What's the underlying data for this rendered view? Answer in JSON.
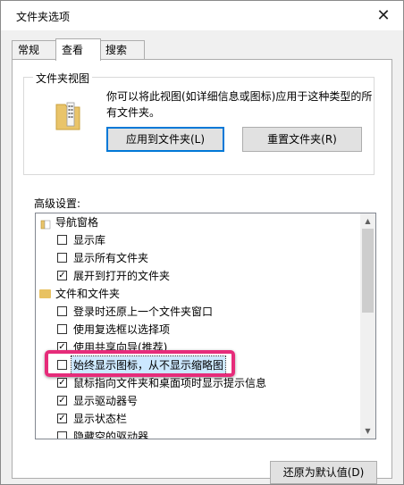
{
  "window": {
    "title": "文件夹选项",
    "close_symbol": "✕"
  },
  "tabs": [
    {
      "label": "常规"
    },
    {
      "label": "查看"
    },
    {
      "label": "搜索"
    }
  ],
  "folder_view": {
    "title": "文件夹视图",
    "description": "你可以将此视图(如详细信息或图标)应用于这种类型的所有文件夹。",
    "apply_button": "应用到文件夹(L)",
    "reset_button": "重置文件夹(R)"
  },
  "advanced": {
    "label": "高级设置:",
    "items": [
      {
        "type": "category",
        "label": "导航窗格",
        "icon": "pane-icon"
      },
      {
        "type": "checkbox",
        "label": "显示库",
        "checked": false
      },
      {
        "type": "checkbox",
        "label": "显示所有文件夹",
        "checked": false
      },
      {
        "type": "checkbox",
        "label": "展开到打开的文件夹",
        "checked": true
      },
      {
        "type": "category",
        "label": "文件和文件夹",
        "icon": "folder-icon"
      },
      {
        "type": "checkbox",
        "label": "登录时还原上一个文件夹窗口",
        "checked": false
      },
      {
        "type": "checkbox",
        "label": "使用复选框以选择项",
        "checked": false
      },
      {
        "type": "checkbox",
        "label": "使用共享向导(推荐)",
        "checked": true
      },
      {
        "type": "checkbox",
        "label": "始终显示图标，从不显示缩略图",
        "checked": false,
        "highlighted": true
      },
      {
        "type": "checkbox",
        "label": "鼠标指向文件夹和桌面项时显示提示信息",
        "checked": true
      },
      {
        "type": "checkbox",
        "label": "显示驱动器号",
        "checked": true
      },
      {
        "type": "checkbox",
        "label": "显示状态栏",
        "checked": true
      },
      {
        "type": "checkbox",
        "label": "隐藏空的驱动器",
        "checked": false
      }
    ]
  },
  "restore_defaults_button": "还原为默认值(D)",
  "colors": {
    "highlight_border": "#e62c7a",
    "focus_blue": "#0078d7",
    "selection_bg": "#cce8ff"
  }
}
